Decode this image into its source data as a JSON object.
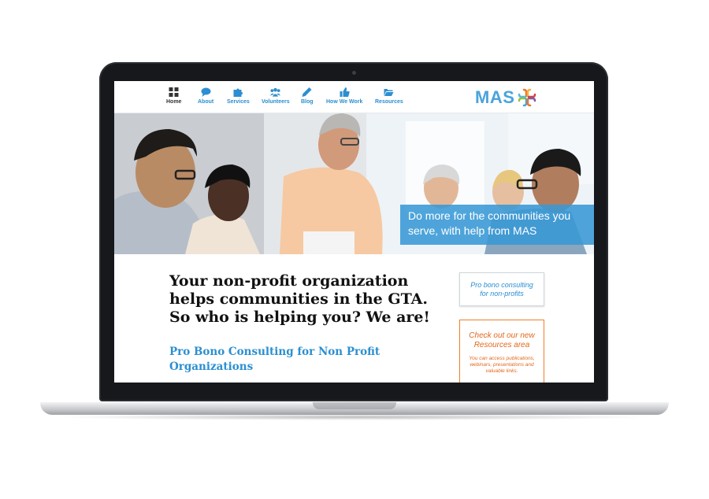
{
  "nav": {
    "items": [
      {
        "label": "Home",
        "icon": "grid-icon"
      },
      {
        "label": "About",
        "icon": "speech-bubble-icon"
      },
      {
        "label": "Services",
        "icon": "puzzle-icon"
      },
      {
        "label": "Volunteers",
        "icon": "people-icon"
      },
      {
        "label": "Blog",
        "icon": "pencil-icon"
      },
      {
        "label": "How We Work",
        "icon": "thumbs-up-icon"
      },
      {
        "label": "Resources",
        "icon": "folder-icon"
      }
    ],
    "active": "Home"
  },
  "logo": {
    "text": "MAS"
  },
  "hero": {
    "caption": "Do more for the communities you serve, with help from MAS"
  },
  "main": {
    "headline": "Your non-profit organization helps communities in the GTA. So who is helping you? We are!",
    "subheading": "Pro Bono Consulting for Non Profit Organizations"
  },
  "sidebar": {
    "consulting_button": "Pro bono consulting for non-profits",
    "promo": {
      "title": "Check out our new Resources area",
      "text": "You can access publications, webinars, presentations and valuable links."
    }
  },
  "colors": {
    "accent_blue": "#2b8fd1",
    "accent_orange": "#e4671a",
    "laptop_bezel": "#16181b"
  }
}
